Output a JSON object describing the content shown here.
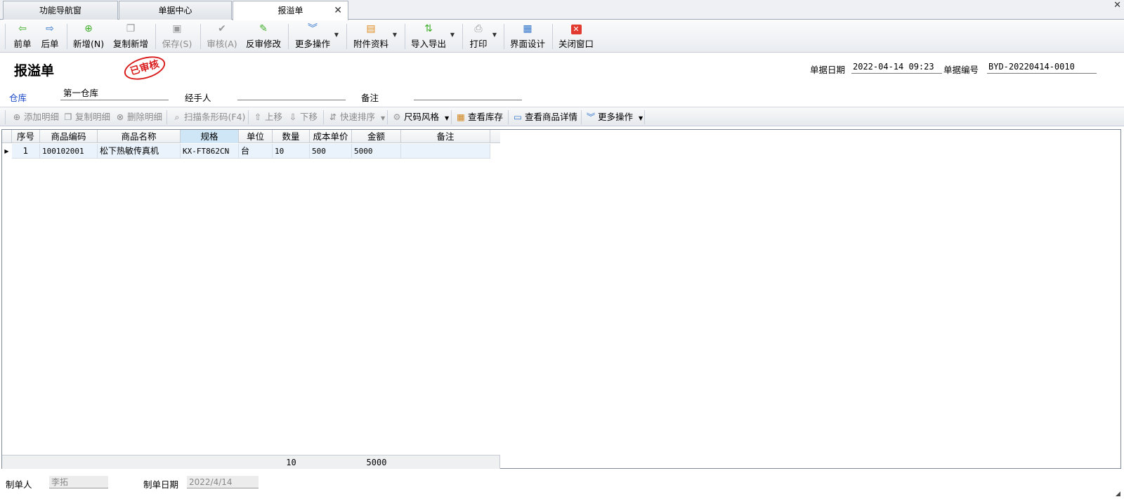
{
  "tabs": [
    {
      "label": "功能导航窗"
    },
    {
      "label": "单据中心"
    },
    {
      "label": "报溢单",
      "active": true
    }
  ],
  "window_close": "✕",
  "toolbar": {
    "prev": "前单",
    "next": "后单",
    "new": "新增(N)",
    "copy_new": "复制新增",
    "save": "保存(S)",
    "review": "审核(A)",
    "unreview": "反审修改",
    "more_ops": "更多操作",
    "attachments": "附件资料",
    "import_export": "导入导出",
    "print": "打印",
    "ui_design": "界面设计",
    "close_window": "关闭窗口"
  },
  "header": {
    "title": "报溢单",
    "stamp": "已审核",
    "date_label": "单据日期",
    "date_value": "2022-04-14 09:23",
    "number_label": "单据编号",
    "number_value": "BYD-20220414-0010"
  },
  "fields": {
    "warehouse_label": "仓库",
    "warehouse_value": "第一仓库",
    "handler_label": "经手人",
    "handler_value": "",
    "remark_label": "备注",
    "remark_value": ""
  },
  "subtoolbar": {
    "add_detail": "添加明细",
    "copy_detail": "复制明细",
    "delete_detail": "删除明细",
    "scan_barcode": "扫描条形码(F4)",
    "move_up": "上移",
    "move_down": "下移",
    "quick_sort": "快速排序",
    "size_style": "尺码风格",
    "view_stock": "查看库存",
    "view_product_detail": "查看商品详情",
    "more_ops": "更多操作"
  },
  "table": {
    "columns": [
      "序号",
      "商品编码",
      "商品名称",
      "规格",
      "单位",
      "数量",
      "成本单价",
      "金额",
      "备注"
    ],
    "rows": [
      [
        "1",
        "100102001",
        "松下热敏传真机",
        "KX-FT862CN",
        "台",
        "10",
        "500",
        "5000",
        ""
      ]
    ],
    "footer": {
      "qty_total": "10",
      "amount_total": "5000"
    }
  },
  "bottom": {
    "maker_label": "制单人",
    "maker_value": "李拓",
    "make_date_label": "制单日期",
    "make_date_value": "2022/4/14"
  },
  "colors": {
    "stamp_red": "#d91c1c",
    "link_blue": "#1a49c8",
    "row_highlight": "#eaf3fb"
  }
}
